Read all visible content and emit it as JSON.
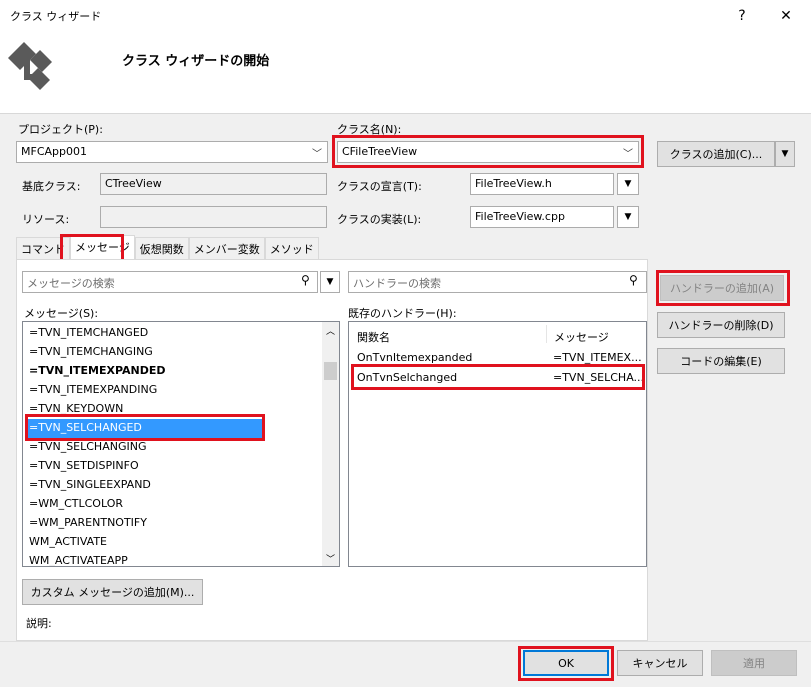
{
  "window": {
    "title": "クラス ウィザード",
    "help_glyph": "?",
    "close_glyph": "✕"
  },
  "header": {
    "title": "クラス ウィザードの開始",
    "icon": "class-wizard-icon"
  },
  "project": {
    "label": "プロジェクト(P):",
    "value": "MFCApp001"
  },
  "class_name": {
    "label": "クラス名(N):",
    "value": "CFileTreeView"
  },
  "add_class_button": "クラスの追加(C)...",
  "base_class": {
    "label": "基底クラス:",
    "value": "CTreeView"
  },
  "resource": {
    "label": "リソース:",
    "value": ""
  },
  "class_decl": {
    "label": "クラスの宣言(T):",
    "value": "FileTreeView.h"
  },
  "class_impl": {
    "label": "クラスの実装(L):",
    "value": "FileTreeView.cpp"
  },
  "tabs": [
    "コマンド",
    "メッセージ",
    "仮想関数",
    "メンバー変数",
    "メソッド"
  ],
  "message_search": {
    "placeholder": "メッセージの検索"
  },
  "handler_search": {
    "placeholder": "ハンドラーの検索"
  },
  "messages": {
    "label": "メッセージ(S):",
    "items": [
      "=TVN_ITEMCHANGED",
      "=TVN_ITEMCHANGING",
      "=TVN_ITEMEXPANDED",
      "=TVN_ITEMEXPANDING",
      "=TVN_KEYDOWN",
      "=TVN_SELCHANGED",
      "=TVN_SELCHANGING",
      "=TVN_SETDISPINFO",
      "=TVN_SINGLEEXPAND",
      "=WM_CTLCOLOR",
      "=WM_PARENTNOTIFY",
      "WM_ACTIVATE",
      "WM_ACTIVATEAPP"
    ]
  },
  "handlers": {
    "label": "既存のハンドラー(H):",
    "col_function": "関数名",
    "col_message": "メッセージ",
    "rows": [
      {
        "function": "OnTvnItemexpanded",
        "message": "=TVN_ITEMEX..."
      },
      {
        "function": "OnTvnSelchanged",
        "message": "=TVN_SELCHA..."
      }
    ]
  },
  "side_buttons": {
    "add_handler": "ハンドラーの追加(A)",
    "delete_handler": "ハンドラーの削除(D)",
    "edit_code": "コードの編集(E)"
  },
  "custom_message_button": "カスタム メッセージの追加(M)...",
  "description_label": "説明:",
  "footer": {
    "ok": "OK",
    "cancel": "キャンセル",
    "apply": "適用"
  },
  "colors": {
    "highlight": "#e0121e",
    "selection": "#3399ff"
  }
}
